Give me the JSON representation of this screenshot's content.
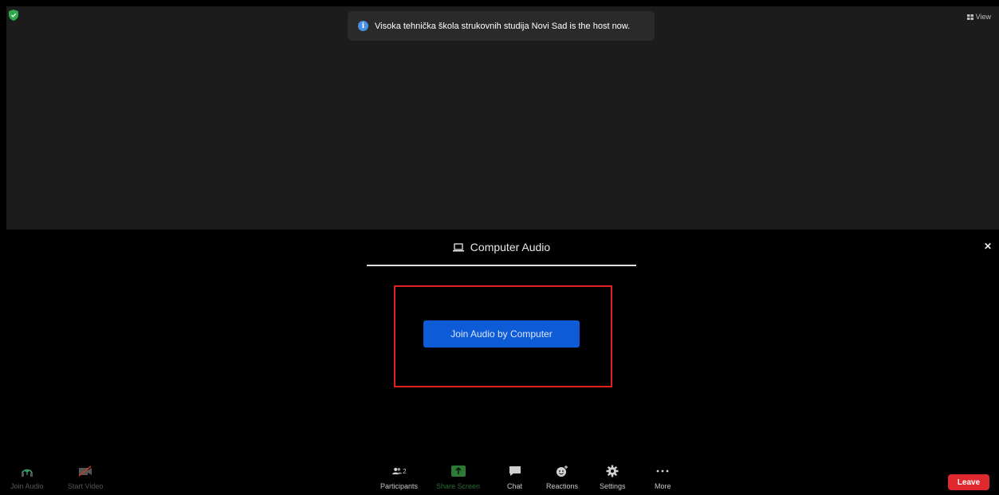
{
  "notification": {
    "text": "Visoka tehnička škola strukovnih studija Novi Sad is the host now."
  },
  "view_label": "View",
  "audio_panel": {
    "tab_label": "Computer Audio",
    "join_button": "Join Audio by Computer"
  },
  "toolbar": {
    "join_audio": "Join Audio",
    "start_video": "Start Video",
    "participants": "Participants",
    "participants_count": "2",
    "share_screen": "Share Screen",
    "chat": "Chat",
    "reactions": "Reactions",
    "settings": "Settings",
    "more": "More",
    "leave": "Leave"
  },
  "colors": {
    "accent_blue": "#0e5bd8",
    "leave_red": "#e0292e",
    "highlight_red": "#e02020",
    "share_green": "#2c6b32"
  }
}
